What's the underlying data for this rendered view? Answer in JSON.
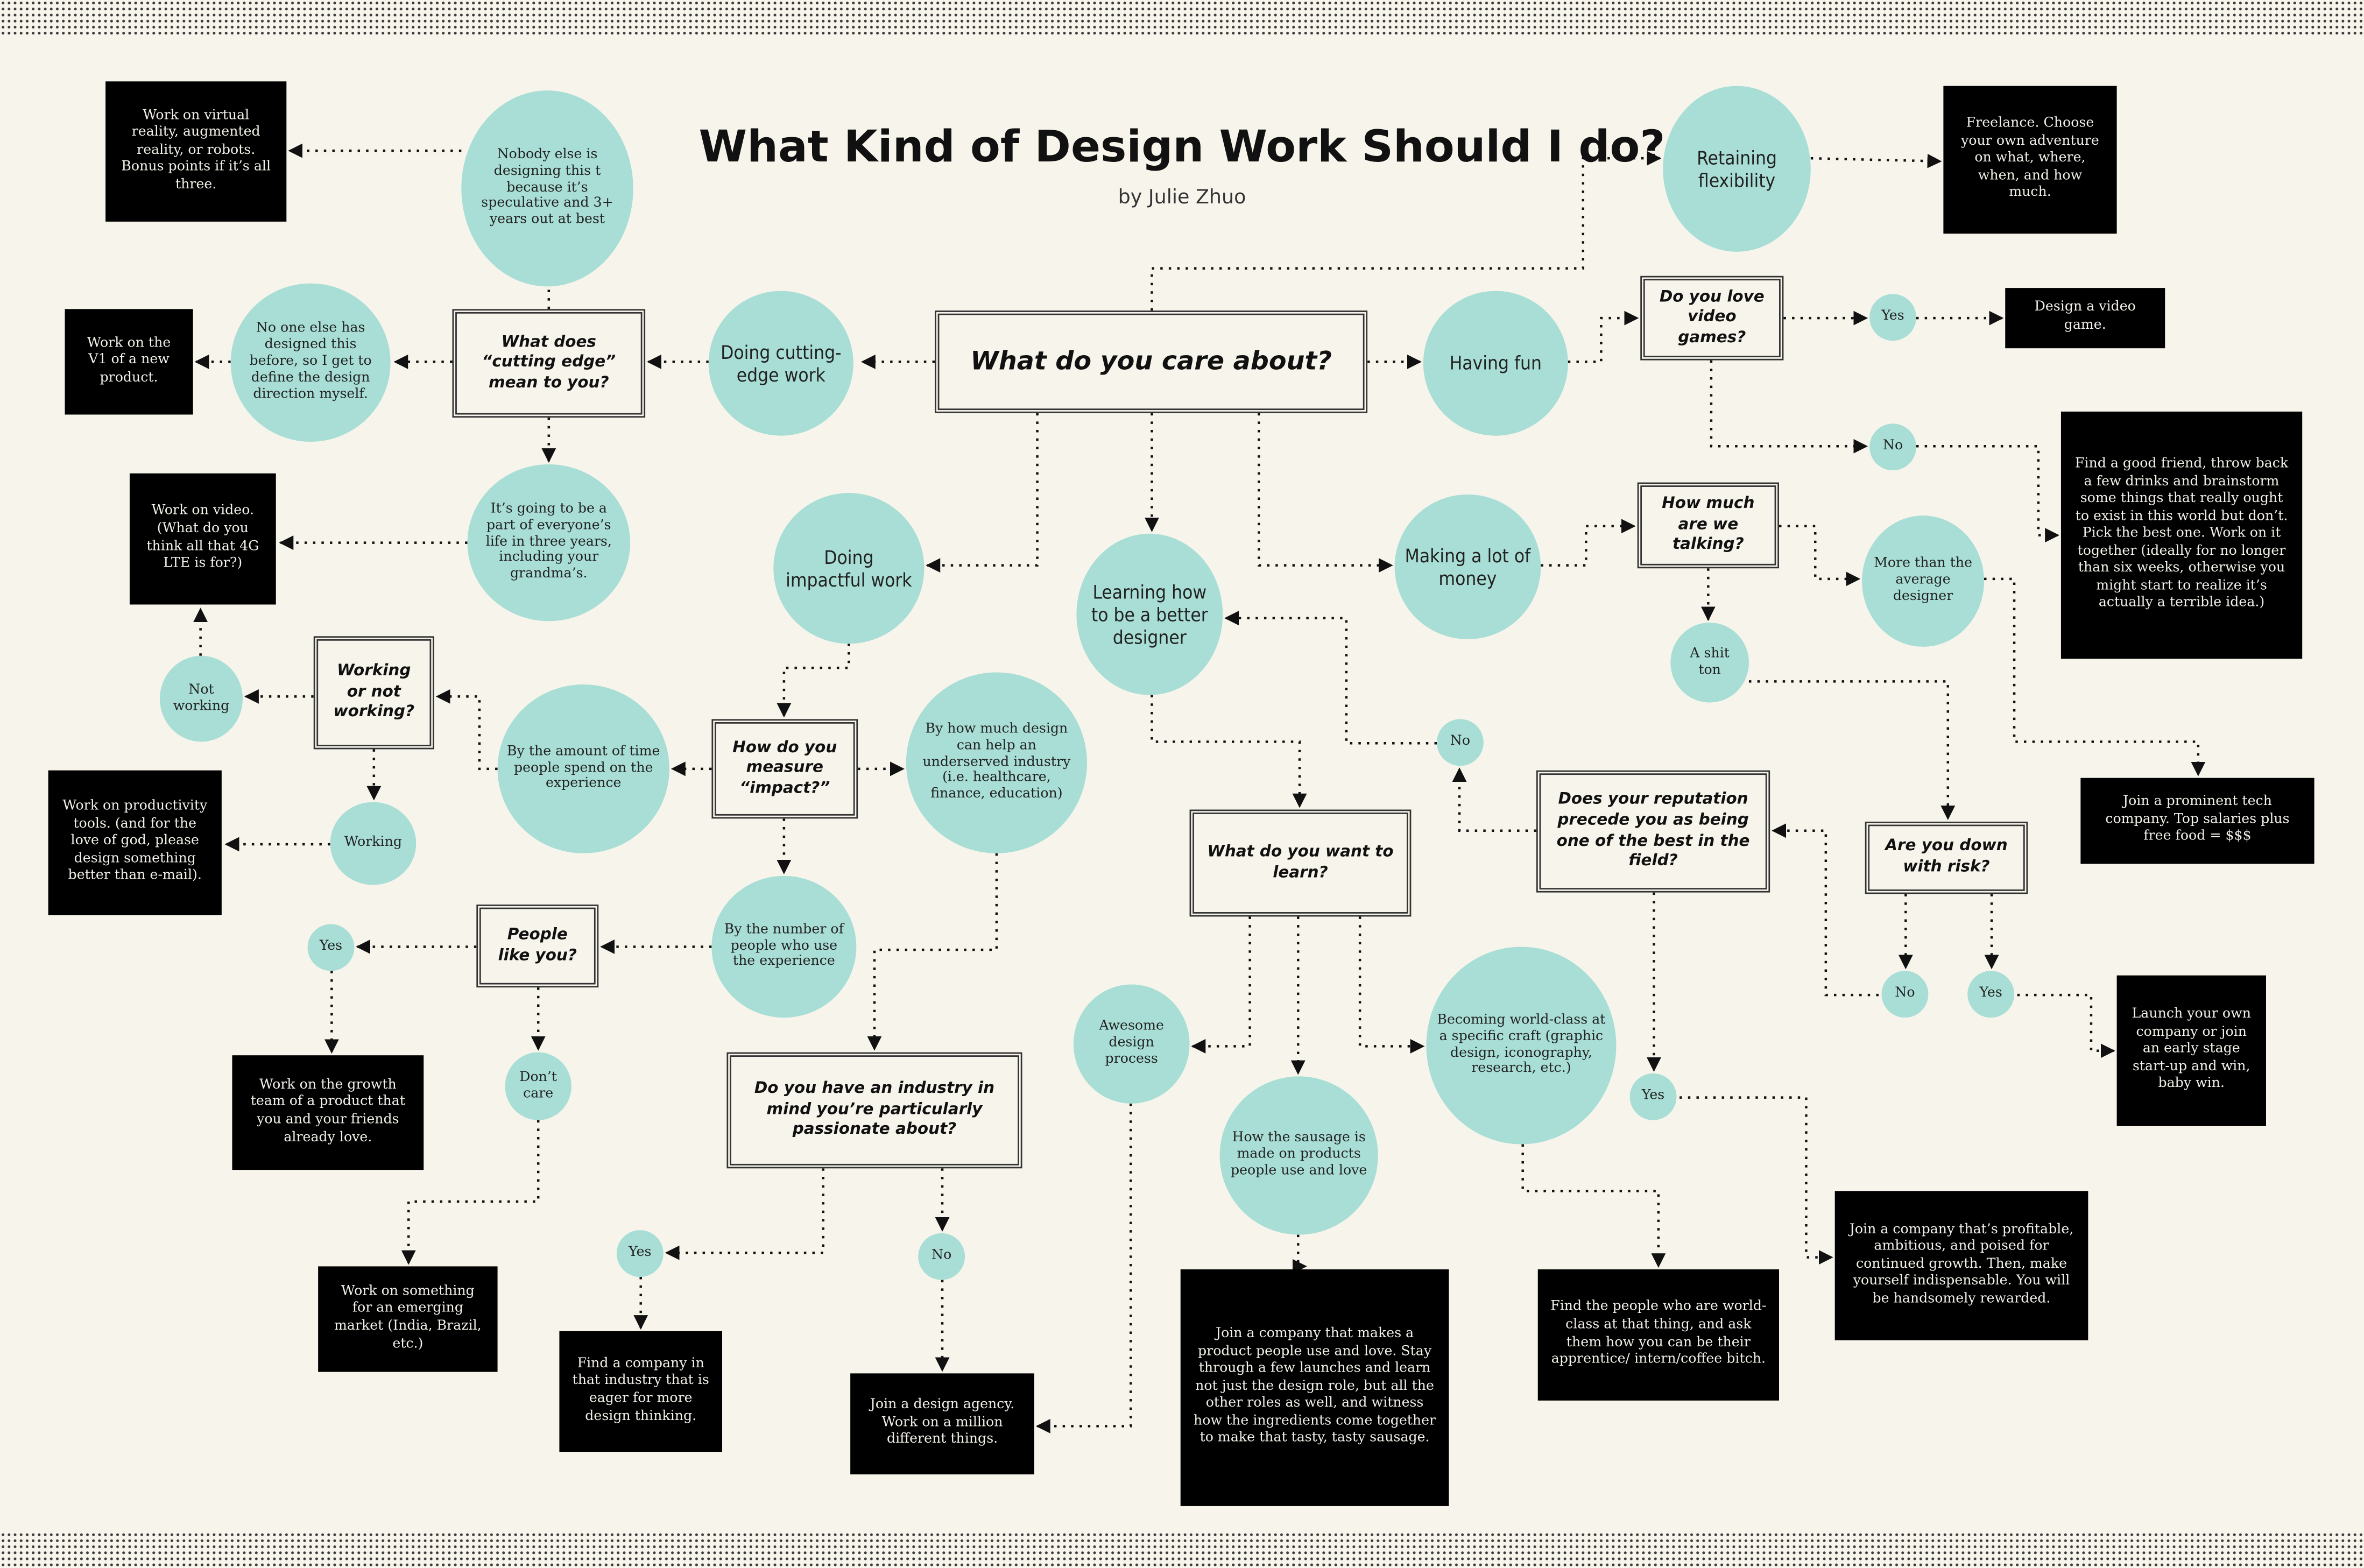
{
  "header": {
    "title": "What Kind of Design Work Should I do?",
    "author": "by Julie Zhuo"
  },
  "colors": {
    "background": "#f7f5eb",
    "option_circle": "#a8ded6",
    "answer_box": "#000000",
    "answer_text": "#f2f0e8",
    "question_border": "#333333"
  },
  "questions": {
    "care_about": "What do you care about?",
    "cutting_edge_meaning": "What does “cutting edge” mean to you?",
    "measure_impact": "How do you measure “impact?”",
    "working_or_not": "Working or not working?",
    "people_like_you": "People like you?",
    "industry_passion": "Do you have an industry in mind you’re particularly passionate about?",
    "want_to_learn": "What do you want to learn?",
    "reputation": "Does your reputation precede you as being one of the best in the field?",
    "love_video_games": "Do you love video games?",
    "how_much": "How much are we talking?",
    "down_with_risk": "Are you down with risk?"
  },
  "options": {
    "cutting_edge": "Doing cutting-edge work",
    "impactful": "Doing impactful work",
    "learning": "Learning how to be a better designer",
    "having_fun": "Having fun",
    "money": "Making a lot of money",
    "flexibility": "Retaining flexibility",
    "nobody_else": "Nobody else is designing this t because it’s speculative and 3+ years out at best",
    "no_one_designed": "No one else has designed this before, so I get to define the design direction myself.",
    "everyone_life": "It’s going to be a part of everyone’s life in three years, including your grandma’s.",
    "not_working": "Not working",
    "working": "Working",
    "time_spent": "By the amount of time people spend on the experience",
    "underserved": "By how much design can help an underserved industry (i.e. healthcare, finance, education)",
    "number_people": "By the number of people who use the experience",
    "people_yes": "Yes",
    "dont_care": "Don’t care",
    "industry_yes": "Yes",
    "industry_no": "No",
    "awesome_process": "Awesome design process",
    "sausage": "How the sausage is made on products people use and love",
    "world_class": "Becoming world-class at a specific craft (graphic design, iconography, research, etc.)",
    "reputation_no": "No",
    "reputation_yes": "Yes",
    "games_yes": "Yes",
    "games_no": "No",
    "shit_ton": "A shit ton",
    "more_than_avg": "More than the average designer",
    "risk_no": "No",
    "risk_yes": "Yes"
  },
  "answers": {
    "vr": "Work on virtual reality, augmented reality, or robots. Bonus points if it’s all three.",
    "v1": "Work on the V1 of a new product.",
    "video": "Work on video. (What do you think all that 4G LTE is for?)",
    "productivity": "Work on productivity tools. (and for the love of god, please design something better than e-mail).",
    "growth": "Work on the growth team of a product that you and your friends already love.",
    "emerging": "Work on something for an emerging market (India, Brazil, etc.)",
    "industry_company": "Find a company in that industry that is eager for more design thinking.",
    "agency": "Join a design agency. Work on a million different things.",
    "sausage_company": "Join a company that makes a product people use and love. Stay through a few launches and learn not just the design role, but all the other roles as well, and witness how the ingredients come together to make that tasty, tasty sausage.",
    "apprentice": "Find the people who are world-class at that thing, and ask them how you can be their apprentice/ intern/coffee bitch.",
    "profitable": "Join a company that’s profitable, ambitious, and poised for continued growth. Then, make yourself indispensable. You will be handsomely rewarded.",
    "freelance": "Freelance. Choose your own adventure on what, where, when, and how much.",
    "video_game": "Design a video game.",
    "friend": "Find a good friend, throw back a few drinks and brainstorm some things that really ought to exist in this world but don’t. Pick the best one. Work on it together (ideally for no longer than six weeks, otherwise you might start to realize it’s actually a terrible idea.)",
    "tech_company": "Join a prominent tech company. Top salaries plus free food = $$$",
    "startup": "Launch your own company or join an early stage start-up and win, baby win."
  }
}
